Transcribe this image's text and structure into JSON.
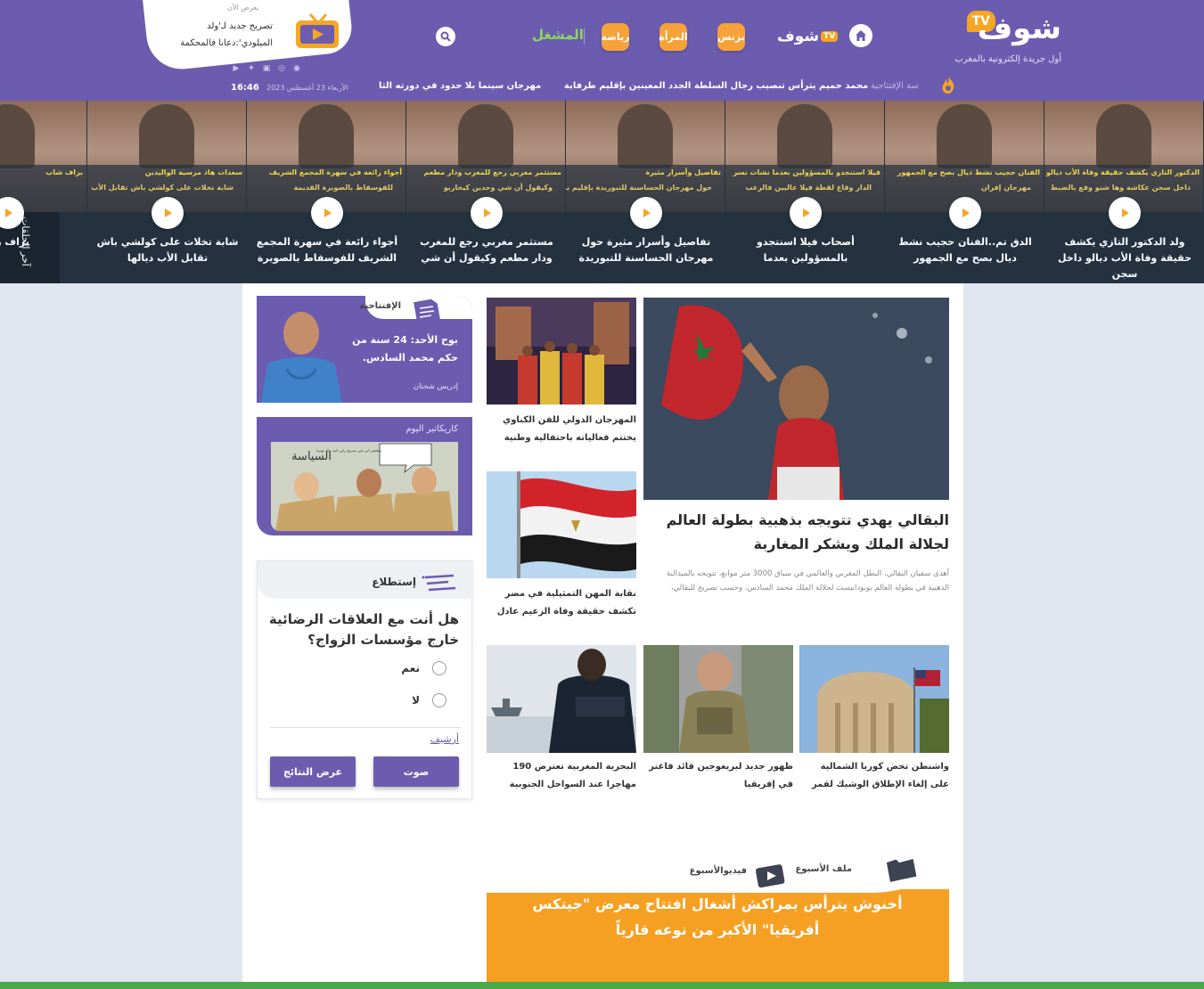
{
  "header": {
    "logo_text": "شوف",
    "logo_tv": "TV",
    "tagline": "أول جريدة إلكترونية بالمغرب",
    "nav_brand": "شوف",
    "nav_brand_tv": "TV",
    "nav_pills": [
      "بزنس",
      "المرأة",
      "رياضة"
    ],
    "nav_link": "المشغل",
    "colors": {
      "primary": "#6b5cb0",
      "accent": "#f5a623",
      "green": "#8ed65a"
    }
  },
  "now_showing": {
    "label": "يعرض الآن",
    "title": "تصريح جديد لـ'ولد الميلودي':دعانا فالمحكمة"
  },
  "ticker": {
    "time": "16:46",
    "date": "الأربعاء 23 أغسطس 2023",
    "items": [
      "مهرجان سينما بلا حدود في دورته الثا",
      "محمد حميم يترأس تنصيب رجال السلطة الجدد المعينين بإقليم طرفاية",
      "سة الإفتتاحية"
    ]
  },
  "video_strip": {
    "side_label": "آخر الحلقات",
    "prev": "‹",
    "next": "›",
    "items": [
      {
        "title": "ولد الدكتور التازي يكشف حقيقة وفاة الأب ديالو داخل سجن",
        "cap1": "الدكتور التازي يكشف حقيقة وفاة الأب ديالو",
        "cap2": "داخل سجن عكاشة وها شنو وقع بالضبط"
      },
      {
        "title": "الدق تم..الفنان حجيب نشط ديال بصح مع الجمهور",
        "cap1": "الفنان حجيب نشط ديال بصح مع الجمهور",
        "cap2": "مهرجان إفران"
      },
      {
        "title": "أصحاب فيلا اسنتجدو بالمسؤولين بعدما",
        "cap1": "فيلا استنجدو بالمسؤولين بعدما نشات نسر",
        "cap2": "الدار وقاع لقطة فيلا عاليين فالرعب"
      },
      {
        "title": "تفاصيل وأسرار مثيرة حول مهرجان الحساسنة للتبوريدة",
        "cap1": "تفاصيل وأسرار مثيرة",
        "cap2": "حول مهرجان الحساسنة للتبوريدة بإقليم برشيد"
      },
      {
        "title": "مستثمر مغربي رجع للمغرب ودار مطعم وكيقول أن شي",
        "cap1": "مستثمر مغربي رجع للمغرب ودار مطعم",
        "cap2": "وكيقول أن شي وحدين كيخاربو"
      },
      {
        "title": "أجواء رائعة في سهرة المجمع الشريف للفوسفاط بالصويرة",
        "cap1": "أجواء رائعة في سهرة المجمع الشريف",
        "cap2": "للفوسفاط بالصويرة القديمة"
      },
      {
        "title": "شابة تخلات على كولشي باش تقابل الأب ديالها",
        "cap1": "سعدات هاد مرسية الواليدين",
        "cap2": "شابة تخلات على كولشي باش تقابل الأب"
      },
      {
        "title": "براف ري",
        "cap1": "براف شاب",
        "cap2": ""
      }
    ]
  },
  "hero": {
    "title": "البقالي يهدي تتويجه بذهبية بطولة العالم لجلالة الملك ويشكر المغاربة",
    "excerpt": "أهدى سفيان البقالي، البطل المغربي والعالمي في سباق 3000 متر موانع، تتويجه بالميدالية الذهبية في بطولة العالم بوبودابيست لجلالة الملك محمد السادس، وحسب تصريح للبقالي،"
  },
  "side_articles": [
    {
      "title": "المهرجان الدولي للفن الكناوي يختتم فعالياته باحتفالية وطنية"
    },
    {
      "title": "نقابة المهن التمثيلية في مصر تكشف حقيقة وفاة الزعيم عادل"
    }
  ],
  "small_articles": [
    {
      "title": "واشنطن تحض كوريا الشمالية على إلغاء الإطلاق الوشيك لقمر"
    },
    {
      "title": "ظهور جديد لبريغوجين قائد فاغنر في إفريقيا"
    },
    {
      "title": "البحرية المغربية تعترض 190 مهاجرا عند السواحل الجنوبية"
    }
  ],
  "opinion": {
    "label": "الإفتتاحية",
    "title": "بوح الأحد: 24 سنة من حكم محمد السادس.",
    "author": "إدريس شحتان"
  },
  "caricature": {
    "label": "كاريكاتير اليوم",
    "sign": "السياسة",
    "bubble": "توقعش ابي شي تصريح راني كنت ولاد تهذيبا"
  },
  "poll": {
    "label": "إستطلاع",
    "question": "هل أنت مع العلاقات الرضائية خارج مؤسسات الزواج؟",
    "options": [
      "نعم",
      "لا"
    ],
    "archive": "أرشيف",
    "vote": "صوت",
    "results": "عرض النتائج"
  },
  "feature": {
    "label_file": "ملف الأسبوع",
    "label_video": "فيديوالأسبوع",
    "title": "أخنوش يترأس بمراكش أشغال افتتاح معرض \"جيتكس أفريقيا\" الأكبر من نوعه قارياً"
  }
}
